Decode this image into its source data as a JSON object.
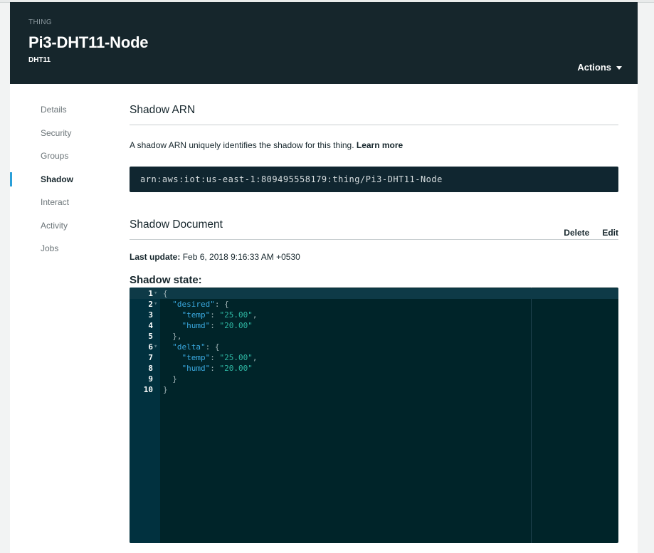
{
  "header": {
    "kicker": "THING",
    "title": "Pi3-DHT11-Node",
    "subtitle": "DHT11",
    "actions_label": "Actions"
  },
  "sidebar": {
    "items": [
      {
        "label": "Details",
        "active": false
      },
      {
        "label": "Security",
        "active": false
      },
      {
        "label": "Groups",
        "active": false
      },
      {
        "label": "Shadow",
        "active": true
      },
      {
        "label": "Interact",
        "active": false
      },
      {
        "label": "Activity",
        "active": false
      },
      {
        "label": "Jobs",
        "active": false
      }
    ]
  },
  "arn_section": {
    "title": "Shadow ARN",
    "description": "A shadow ARN uniquely identifies the shadow for this thing.",
    "learn_more": "Learn more",
    "arn": "arn:aws:iot:us-east-1:809495558179:thing/Pi3-DHT11-Node"
  },
  "document_section": {
    "title": "Shadow Document",
    "delete_label": "Delete",
    "edit_label": "Edit",
    "last_update_label": "Last update:",
    "last_update_value": "Feb 6, 2018 9:16:33 AM +0530",
    "state_title": "Shadow state:"
  },
  "editor": {
    "line_numbers": [
      "1",
      "2",
      "3",
      "4",
      "5",
      "6",
      "7",
      "8",
      "9",
      "10"
    ],
    "foldable_lines": [
      "1",
      "2",
      "6"
    ],
    "active_line": "1"
  },
  "colors": {
    "header_bg": "#16262c",
    "accent": "#2a9fd8",
    "editor_bg": "#002429",
    "json_key": "#3aa9e0",
    "json_string": "#2eb8a4"
  }
}
